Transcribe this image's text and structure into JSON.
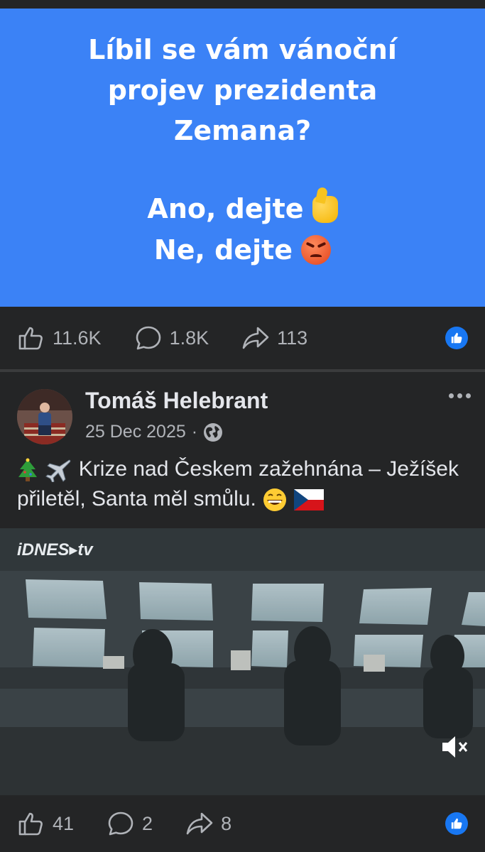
{
  "poll_post": {
    "question": "Líbil se vám vánoční projev prezidenta Zemana?",
    "answer_yes": "Ano, dejte",
    "answer_no": "Ne, dejte",
    "yes_emoji": "thumbs-up",
    "no_emoji": "angry-face",
    "likes": "11.6K",
    "comments": "1.8K",
    "shares": "113"
  },
  "video_post": {
    "author": "Tomáš Helebrant",
    "date": "25 Dec 2025",
    "separator": "·",
    "visibility_icon": "globe-icon",
    "text": "Krize nad Českem zažehnána – Ježíšek přiletěl, Santa měl smůlu.",
    "leading_emojis": [
      "christmas-tree",
      "airplane"
    ],
    "trailing_emojis": [
      "grinning-face",
      "czech-flag"
    ],
    "video_brand": "iDNES▸tv",
    "likes": "41",
    "comments": "2",
    "shares": "8"
  },
  "colors": {
    "poll_background": "#3b82f6",
    "post_background": "#242526",
    "like_badge": "#1877f2",
    "secondary_text": "#b0b3b8"
  }
}
